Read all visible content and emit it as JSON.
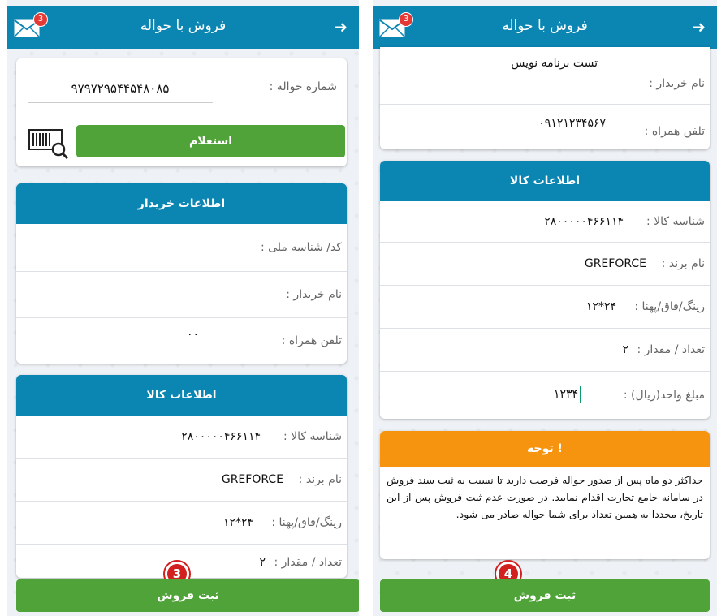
{
  "header": {
    "title": "فروش با حواله",
    "badge_count": "3"
  },
  "screen_a": {
    "inquiry": {
      "label": "شماره حواله :",
      "value": "۹۷۹۷۲۹۵۴۴۵۴۸۰۸۵",
      "button": "استعلام"
    },
    "buyer": {
      "title": "اطلاعات خریدار",
      "national_label": "کد/ شناسه ملی :",
      "name_label": "نام خریدار :",
      "phone_label": "تلفن همراه :",
      "phone_value": "۰۰"
    },
    "goods": {
      "title": "اطلاعات کالا",
      "id_label": "شناسه کالا :",
      "id_value": "۲۸۰۰۰۰۰۴۶۶۱۱۴",
      "brand_label": "نام برند :",
      "brand_value": "GREFORCE",
      "size_label": "رینگ/فاق/پهنا :",
      "size_value": "۲۴*۱۲",
      "qty_label": "تعداد / مقدار :",
      "qty_value": "۲"
    },
    "submit": "ثبت فروش",
    "marker": "3"
  },
  "screen_b": {
    "buyer": {
      "name_label": "نام خریدار :",
      "name_value": "تست برنامه نویس",
      "phone_label": "تلفن همراه :",
      "phone_value": "۰۹۱۲۱۲۳۴۵۶۷"
    },
    "goods": {
      "title": "اطلاعات کالا",
      "id_label": "شناسه کالا :",
      "id_value": "۲۸۰۰۰۰۰۴۶۶۱۱۴",
      "brand_label": "نام برند :",
      "brand_value": "GREFORCE",
      "size_label": "رینگ/فاق/پهنا :",
      "size_value": "۲۴*۱۲",
      "qty_label": "تعداد / مقدار :",
      "qty_value": "۲",
      "price_label": "مبلغ واحد(ریال) :",
      "price_value": "۱۲۳۴"
    },
    "notice": {
      "title": "توجه !",
      "text": "حداکثر دو ماه پس از صدور حواله فرصت دارید تا نسبت به ثبت سند فروش در سامانه جامع تجارت اقدام نمایید. در صورت عدم ثبت فروش پس از این تاریخ، مجددا به همین تعداد برای شما حواله صادر می شود."
    },
    "submit": "ثبت فروش",
    "marker": "4"
  },
  "colors": {
    "header": "#0b85b2",
    "button": "#4fa338",
    "notice": "#f7940f",
    "marker": "#d21f1f"
  }
}
